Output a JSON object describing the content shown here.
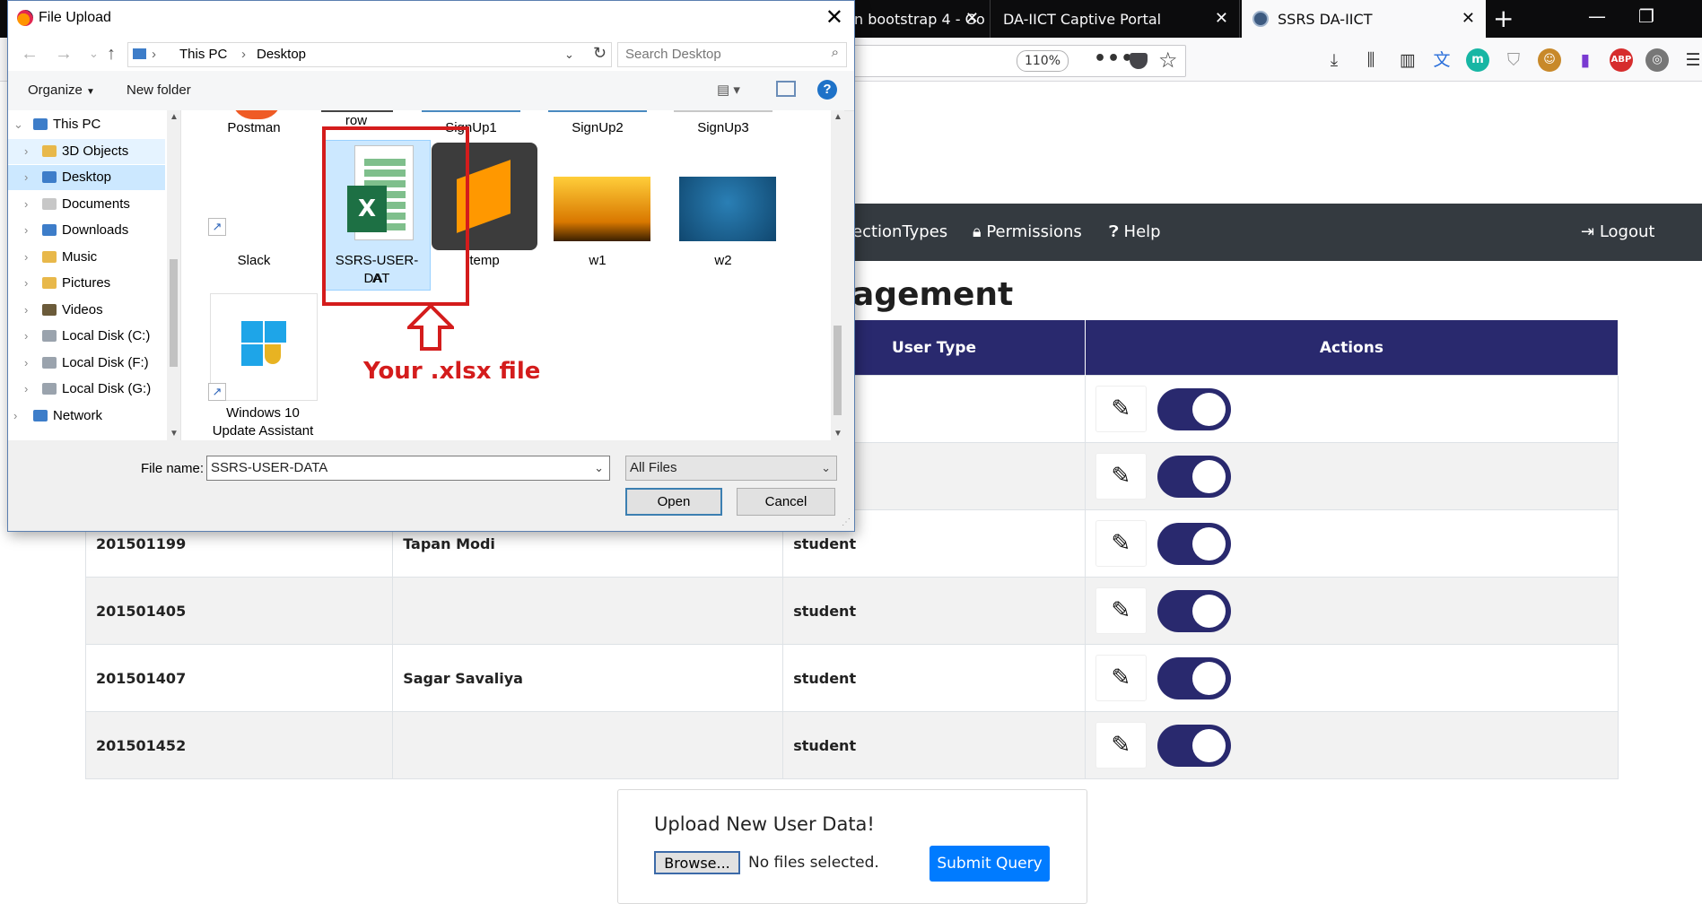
{
  "browser": {
    "tabs": [
      {
        "label": "n bootstrap 4 - Go"
      },
      {
        "label": "DA-IICT Captive Portal"
      },
      {
        "label": "SSRS DA-IICT"
      }
    ],
    "zoom": "110%"
  },
  "site": {
    "nav": {
      "connection_types": "ectionTypes",
      "permissions": "Permissions",
      "help": "Help",
      "logout": "Logout"
    },
    "heading": "agement",
    "table": {
      "headers": [
        "User Type",
        "Actions"
      ],
      "rows": [
        {
          "id": "",
          "name": "",
          "type": ""
        },
        {
          "id": "",
          "name": "",
          "type": ""
        },
        {
          "id": "201501199",
          "name": "Tapan Modi",
          "type": "student"
        },
        {
          "id": "201501405",
          "name": "",
          "type": "student"
        },
        {
          "id": "201501407",
          "name": "Sagar Savaliya",
          "type": "student"
        },
        {
          "id": "201501452",
          "name": "",
          "type": "student"
        }
      ]
    },
    "upload": {
      "title": "Upload New User Data!",
      "browse_label": "Browse...",
      "no_file_text": "No files selected.",
      "submit_label": "Submit Query"
    }
  },
  "dialog": {
    "title": "File Upload",
    "path": [
      "This PC",
      "Desktop"
    ],
    "search_placeholder": "Search Desktop",
    "organize_label": "Organize",
    "new_folder_label": "New folder",
    "nav_items": [
      {
        "label": "This PC"
      },
      {
        "label": "3D Objects"
      },
      {
        "label": "Desktop"
      },
      {
        "label": "Documents"
      },
      {
        "label": "Downloads"
      },
      {
        "label": "Music"
      },
      {
        "label": "Pictures"
      },
      {
        "label": "Videos"
      },
      {
        "label": "Local Disk (C:)"
      },
      {
        "label": "Local Disk (F:)"
      },
      {
        "label": "Local Disk (G:)"
      },
      {
        "label": "Network"
      }
    ],
    "files": {
      "postman": "Postman",
      "row_partial": "row",
      "signup1": "SignUp1",
      "signup2": "SignUp2",
      "signup3": "SignUp3",
      "slack": "Slack",
      "ssrs_line1": "SSRS-USER-DAT",
      "ssrs_line2": "A",
      "temp": "temp",
      "w1": "w1",
      "w2": "w2",
      "win10_line1": "Windows 10",
      "win10_line2": "Update Assistant"
    },
    "annotation": "Your .xlsx file",
    "file_name_label": "File name:",
    "file_name_value": "SSRS-USER-DATA",
    "filter_value": "All Files",
    "open_label": "Open",
    "cancel_label": "Cancel"
  },
  "colors": {
    "accent_navy": "#29296e",
    "annotation_red": "#d41c1c",
    "submit_blue": "#007bff"
  }
}
